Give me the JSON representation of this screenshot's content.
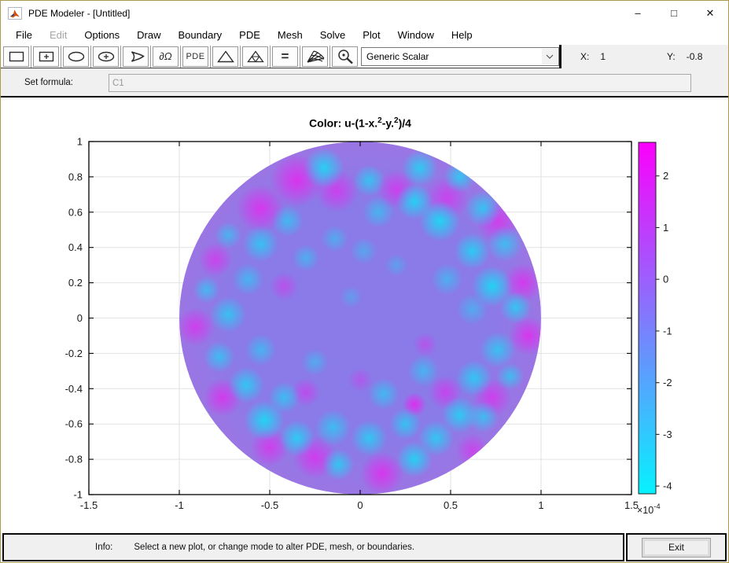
{
  "window": {
    "title": "PDE Modeler - [Untitled]",
    "controls": {
      "minimize": "–",
      "maximize": "□",
      "close": "✕"
    }
  },
  "menu": {
    "items": [
      {
        "label": "File",
        "enabled": true
      },
      {
        "label": "Edit",
        "enabled": false
      },
      {
        "label": "Options",
        "enabled": true
      },
      {
        "label": "Draw",
        "enabled": true
      },
      {
        "label": "Boundary",
        "enabled": true
      },
      {
        "label": "PDE",
        "enabled": true
      },
      {
        "label": "Mesh",
        "enabled": true
      },
      {
        "label": "Solve",
        "enabled": true
      },
      {
        "label": "Plot",
        "enabled": true
      },
      {
        "label": "Window",
        "enabled": true
      },
      {
        "label": "Help",
        "enabled": true
      }
    ]
  },
  "toolbar": {
    "buttons": [
      {
        "name": "draw-rectangle"
      },
      {
        "name": "draw-rectangle-centered"
      },
      {
        "name": "draw-ellipse"
      },
      {
        "name": "draw-ellipse-centered"
      },
      {
        "name": "draw-polygon"
      },
      {
        "name": "boundary-mode",
        "label": "∂Ω"
      },
      {
        "name": "pde-mode",
        "label": "PDE"
      },
      {
        "name": "initialize-mesh"
      },
      {
        "name": "refine-mesh"
      },
      {
        "name": "solve-pde",
        "label": "="
      },
      {
        "name": "plot-3d"
      },
      {
        "name": "zoom"
      }
    ],
    "plot_type": "Generic Scalar",
    "x_label": "X:",
    "x_value": "1",
    "y_label": "Y:",
    "y_value": "-0.8"
  },
  "formula": {
    "label": "Set formula:",
    "value": "C1"
  },
  "chart_data": {
    "type": "heatmap",
    "title": "Color: u-(1-x.^2-y.^2)/4",
    "title_parts": {
      "p1": "Color: u-(1-x.",
      "s1": "2",
      "p2": "-y.",
      "s2": "2",
      "p3": ")/4"
    },
    "xlim": [
      -1.5,
      1.5
    ],
    "ylim": [
      -1,
      1
    ],
    "x_ticks": [
      "-1.5",
      "-1",
      "-0.5",
      "0",
      "0.5",
      "1",
      "1.5"
    ],
    "y_ticks": [
      "1",
      "0.8",
      "0.6",
      "0.4",
      "0.2",
      "0",
      "-0.2",
      "-0.4",
      "-0.6",
      "-0.8",
      "-1"
    ],
    "grid": true,
    "legend_position": "colorbar-right",
    "domain": {
      "shape": "circle",
      "center": [
        0,
        0
      ],
      "radius": 1
    },
    "colormap": "cool",
    "solution": {
      "base_color": "#8a7be8",
      "edge_color": "#9a76e4",
      "cyan_color": "#17dcf6",
      "magenta_color": "#ef1ef0",
      "cyan_spots": [
        [
          -0.2,
          0.85,
          0.09,
          0.9
        ],
        [
          0.05,
          0.78,
          0.07,
          0.75
        ],
        [
          0.33,
          0.85,
          0.08,
          0.85
        ],
        [
          0.55,
          0.8,
          0.07,
          0.8
        ],
        [
          0.3,
          0.66,
          0.08,
          0.9
        ],
        [
          0.1,
          0.6,
          0.07,
          0.6
        ],
        [
          0.44,
          0.55,
          0.09,
          0.95
        ],
        [
          0.68,
          0.62,
          0.08,
          0.8
        ],
        [
          0.8,
          0.42,
          0.08,
          0.7
        ],
        [
          0.62,
          0.38,
          0.08,
          0.85
        ],
        [
          0.73,
          0.18,
          0.09,
          0.95
        ],
        [
          0.86,
          0.06,
          0.07,
          0.8
        ],
        [
          0.62,
          0.05,
          0.07,
          0.5
        ],
        [
          0.76,
          -0.18,
          0.08,
          0.75
        ],
        [
          0.63,
          -0.34,
          0.08,
          0.8
        ],
        [
          0.83,
          -0.33,
          0.06,
          0.7
        ],
        [
          0.55,
          -0.55,
          0.08,
          0.85
        ],
        [
          0.68,
          -0.56,
          0.07,
          0.7
        ],
        [
          0.42,
          -0.68,
          0.08,
          0.8
        ],
        [
          0.25,
          -0.6,
          0.07,
          0.75
        ],
        [
          0.3,
          -0.8,
          0.08,
          0.9
        ],
        [
          0.05,
          -0.68,
          0.08,
          0.8
        ],
        [
          -0.12,
          -0.83,
          0.07,
          0.8
        ],
        [
          -0.15,
          -0.62,
          0.08,
          0.7
        ],
        [
          -0.35,
          -0.68,
          0.08,
          0.85
        ],
        [
          -0.53,
          -0.58,
          0.09,
          0.95
        ],
        [
          -0.42,
          -0.45,
          0.07,
          0.7
        ],
        [
          -0.63,
          -0.38,
          0.08,
          0.8
        ],
        [
          -0.78,
          -0.22,
          0.07,
          0.7
        ],
        [
          -0.55,
          -0.18,
          0.07,
          0.6
        ],
        [
          -0.73,
          0.02,
          0.08,
          0.75
        ],
        [
          -0.85,
          0.16,
          0.06,
          0.65
        ],
        [
          -0.62,
          0.22,
          0.07,
          0.6
        ],
        [
          -0.55,
          0.42,
          0.08,
          0.75
        ],
        [
          -0.73,
          0.47,
          0.06,
          0.6
        ],
        [
          -0.4,
          0.55,
          0.07,
          0.65
        ],
        [
          -0.3,
          0.34,
          0.06,
          0.55
        ],
        [
          -0.14,
          0.45,
          0.06,
          0.5
        ],
        [
          0.02,
          0.38,
          0.06,
          0.45
        ],
        [
          0.48,
          0.22,
          0.07,
          0.55
        ],
        [
          0.35,
          -0.3,
          0.07,
          0.6
        ],
        [
          0.13,
          -0.43,
          0.07,
          0.65
        ],
        [
          -0.25,
          -0.25,
          0.06,
          0.5
        ],
        [
          0.57,
          0.88,
          0.05,
          0.6
        ],
        [
          0.2,
          0.3,
          0.05,
          0.4
        ],
        [
          -0.05,
          0.12,
          0.05,
          0.35
        ]
      ],
      "magenta_spots": [
        [
          -0.35,
          0.78,
          0.11,
          0.85
        ],
        [
          -0.13,
          0.72,
          0.09,
          0.7
        ],
        [
          -0.55,
          0.62,
          0.1,
          0.8
        ],
        [
          0.2,
          0.73,
          0.08,
          0.7
        ],
        [
          0.48,
          0.68,
          0.09,
          0.65
        ],
        [
          0.76,
          0.55,
          0.09,
          0.7
        ],
        [
          0.9,
          0.2,
          0.08,
          0.75
        ],
        [
          0.93,
          -0.1,
          0.08,
          0.8
        ],
        [
          0.73,
          -0.45,
          0.08,
          0.7
        ],
        [
          0.47,
          -0.42,
          0.07,
          0.65
        ],
        [
          0.3,
          -0.49,
          0.05,
          0.9
        ],
        [
          0.12,
          -0.88,
          0.09,
          0.8
        ],
        [
          -0.25,
          -0.79,
          0.09,
          0.75
        ],
        [
          -0.5,
          -0.73,
          0.08,
          0.7
        ],
        [
          -0.76,
          -0.45,
          0.08,
          0.75
        ],
        [
          -0.91,
          -0.05,
          0.08,
          0.7
        ],
        [
          -0.8,
          0.33,
          0.07,
          0.65
        ],
        [
          -0.42,
          0.18,
          0.06,
          0.5
        ],
        [
          -0.3,
          -0.42,
          0.06,
          0.55
        ],
        [
          0.36,
          -0.15,
          0.05,
          0.45
        ],
        [
          0.0,
          -0.35,
          0.05,
          0.4
        ],
        [
          0.62,
          -0.75,
          0.07,
          0.6
        ]
      ]
    },
    "colorbar": {
      "min": -4.15,
      "max": 2.65,
      "ticks": [
        "2",
        "1",
        "0",
        "-1",
        "-2",
        "-3",
        "-4"
      ],
      "exponent_text": "×10",
      "exponent_sup": "-4",
      "top_color": "#fc00fc",
      "bottom_color": "#06f2fe"
    }
  },
  "statusbar": {
    "info_label": "Info:",
    "message": "Select a new plot, or change mode to alter PDE, mesh, or boundaries.",
    "exit_label": "Exit"
  }
}
